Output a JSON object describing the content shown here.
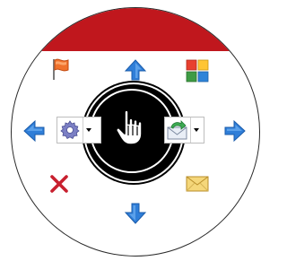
{
  "menu": {
    "accent_color": "#c0171d",
    "hub_color": "#000000",
    "items": {
      "top": "arrow-up-icon",
      "top_left": "flag-icon",
      "top_right": "color-tiles-icon",
      "left": "arrow-left-icon",
      "right": "arrow-right-icon",
      "bottom_left": "close-icon",
      "bottom_right": "envelope-icon",
      "bottom": "arrow-down-icon"
    },
    "center_left": "gear-icon",
    "center_right": "reply-mail-icon",
    "center": "hand-cursor-icon"
  }
}
